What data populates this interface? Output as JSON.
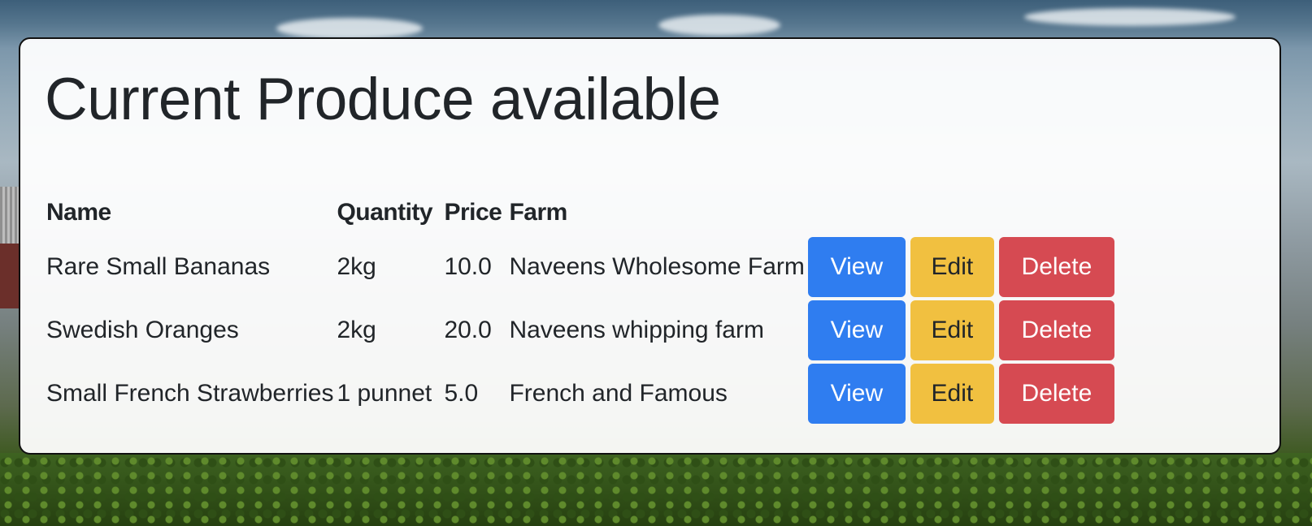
{
  "page": {
    "title": "Current Produce available"
  },
  "table": {
    "headers": {
      "name": "Name",
      "quantity": "Quantity",
      "price": "Price",
      "farm": "Farm"
    },
    "rows": [
      {
        "name": "Rare Small Bananas",
        "quantity": "2kg",
        "price": "10.0",
        "farm": "Naveens Wholesome Farm"
      },
      {
        "name": "Swedish Oranges",
        "quantity": "2kg",
        "price": "20.0",
        "farm": "Naveens whipping farm"
      },
      {
        "name": "Small French Strawberries",
        "quantity": "1 punnet",
        "price": "5.0",
        "farm": "French and Famous"
      }
    ]
  },
  "actions": {
    "view_label": "View",
    "edit_label": "Edit",
    "delete_label": "Delete"
  },
  "colors": {
    "view": "#2f7df0",
    "edit": "#f1c040",
    "delete": "#d64a52"
  }
}
